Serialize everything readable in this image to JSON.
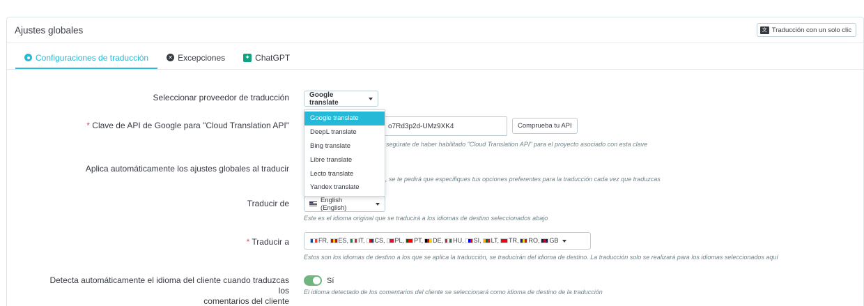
{
  "header": {
    "title": "Ajustes globales",
    "one_click_button": "Traducción con un solo clic"
  },
  "tabs": [
    {
      "label": "Configuraciones de traducción",
      "icon": "gear-icon",
      "active": true
    },
    {
      "label": "Excepciones",
      "icon": "close-circle-icon",
      "active": false
    },
    {
      "label": "ChatGPT",
      "icon": "chatgpt-icon",
      "active": false
    }
  ],
  "form": {
    "provider": {
      "label": "Seleccionar proveedor de traducción",
      "selected": "Google translate",
      "options": [
        "Google translate",
        "DeepL translate",
        "Bing translate",
        "Libre translate",
        "Lecto translate",
        "Yandex translate"
      ]
    },
    "api_key": {
      "required_mark": "*",
      "label": "Clave de API de Google para \"Cloud Translation API\"",
      "value": "o7Rd3p2d-UMz9XK4",
      "test_button": "Comprueba tu API",
      "help": "segúrate de haber habilitado \"Cloud Translation API\" para el proyecto asociado con esta clave"
    },
    "auto_apply": {
      "label": "Aplica automáticamente los ajustes globales al traducir",
      "help": ", se te pedirá que especifiques tus opciones preferentes para la traducción cada vez que traduzcas"
    },
    "translate_from": {
      "label": "Traducir de",
      "value": "English (English)",
      "help": "Este es el idioma original que se traducirá a los idiomas de destino seleccionados abajo"
    },
    "translate_to": {
      "required_mark": "*",
      "label": "Traducir a",
      "languages": [
        {
          "code": "FR",
          "suffix": ",",
          "colors": [
            "#0055a4",
            "#ffffff",
            "#ef4135"
          ]
        },
        {
          "code": "ES",
          "suffix": ",",
          "colors": [
            "#c60b1e",
            "#ffc400",
            "#c60b1e"
          ]
        },
        {
          "code": "IT",
          "suffix": ",",
          "colors": [
            "#009246",
            "#ffffff",
            "#ce2b37"
          ]
        },
        {
          "code": "CS",
          "suffix": ",",
          "colors": [
            "#ffffff",
            "#d7141a",
            "#11457e"
          ]
        },
        {
          "code": "PL",
          "suffix": ",",
          "colors": [
            "#ffffff",
            "#dc143c",
            "#dc143c"
          ]
        },
        {
          "code": "PT",
          "suffix": ",",
          "colors": [
            "#006600",
            "#ff0000",
            "#ff0000"
          ]
        },
        {
          "code": "DE",
          "suffix": ",",
          "colors": [
            "#000000",
            "#dd0000",
            "#ffce00"
          ]
        },
        {
          "code": "HU",
          "suffix": ",",
          "colors": [
            "#ce2939",
            "#ffffff",
            "#477050"
          ]
        },
        {
          "code": "SI",
          "suffix": ",",
          "colors": [
            "#ffffff",
            "#0000ff",
            "#ff0000"
          ]
        },
        {
          "code": "LT",
          "suffix": ",",
          "colors": [
            "#fdb913",
            "#006a44",
            "#c1272d"
          ]
        },
        {
          "code": "TR",
          "suffix": ",",
          "colors": [
            "#e30a17",
            "#e30a17",
            "#e30a17"
          ]
        },
        {
          "code": "RO",
          "suffix": ",",
          "colors": [
            "#002b7f",
            "#fcd116",
            "#ce1126"
          ]
        },
        {
          "code": "GB",
          "suffix": "",
          "colors": [
            "#012169",
            "#c8102e",
            "#012169"
          ]
        }
      ],
      "help": "Estos son los idiomas de destino a los que se aplica la traducción, se traducirán del idioma de destino. La traducción solo se realizará para los idiomas seleccionados aquí"
    },
    "detect_language": {
      "label_line1": "Detecta automáticamente el idioma del cliente cuando traduzcas los",
      "label_line2": "comentarios del cliente",
      "toggle_label": "Sí",
      "help": "El idioma detectado de los comentarios del cliente se seleccionará como idioma de destino de la traducción"
    }
  },
  "colors": {
    "accent": "#25b9d7",
    "toggle_on": "#70b580",
    "required": "#c05c67"
  }
}
